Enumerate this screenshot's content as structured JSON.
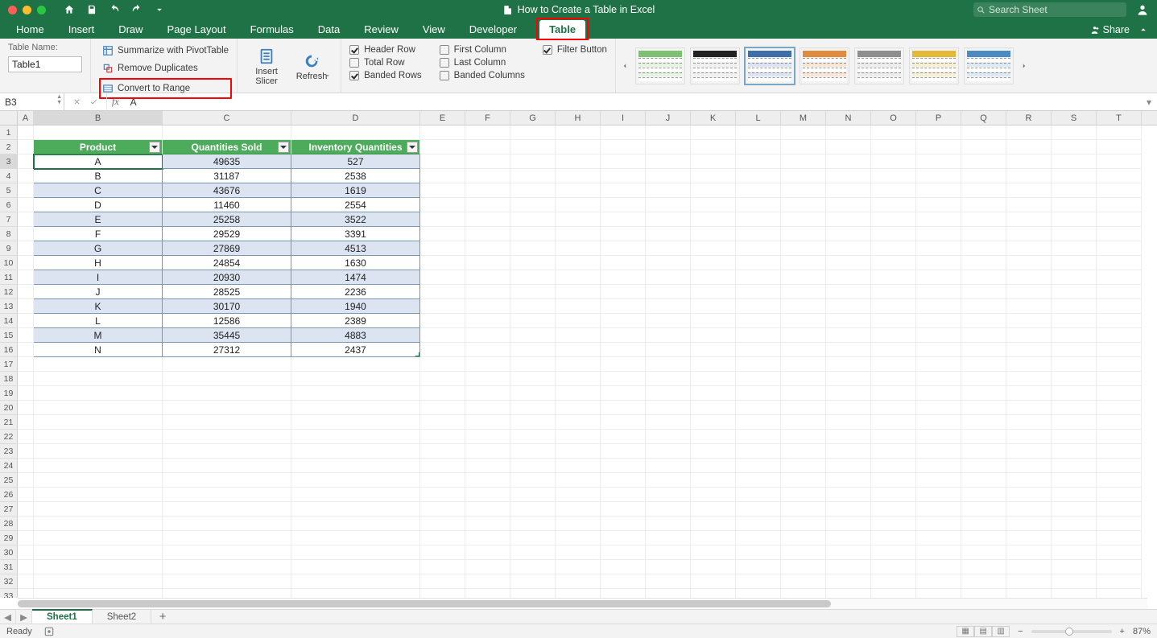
{
  "title": "How to Create a Table in Excel",
  "search_placeholder": "Search Sheet",
  "ribbon_tabs": [
    "Home",
    "Insert",
    "Draw",
    "Page Layout",
    "Formulas",
    "Data",
    "Review",
    "View",
    "Developer",
    "Table"
  ],
  "active_tab": "Table",
  "share_label": "Share",
  "table_name_label": "Table Name:",
  "table_name_value": "Table1",
  "tools": {
    "pivot": "Summarize with PivotTable",
    "dedup": "Remove Duplicates",
    "convert": "Convert to Range",
    "insert_slicer": "Insert Slicer",
    "refresh": "Refresh"
  },
  "options_col1": [
    {
      "label": "Header Row",
      "checked": true
    },
    {
      "label": "Total Row",
      "checked": false
    },
    {
      "label": "Banded Rows",
      "checked": true
    }
  ],
  "options_col2": [
    {
      "label": "First Column",
      "checked": false
    },
    {
      "label": "Last Column",
      "checked": false
    },
    {
      "label": "Banded Columns",
      "checked": false
    }
  ],
  "options_col3": [
    {
      "label": "Filter Button",
      "checked": true
    }
  ],
  "style_presets": [
    {
      "hdr": "#7fc173",
      "alt": "#e5f3e1",
      "sel": false
    },
    {
      "hdr": "#222222",
      "alt": "#f0f0f0",
      "sel": false
    },
    {
      "hdr": "#3f6fa8",
      "alt": "#dbe4f0",
      "sel": true
    },
    {
      "hdr": "#e08b3e",
      "alt": "#f7e6d6",
      "sel": false
    },
    {
      "hdr": "#8e8e8e",
      "alt": "#ececec",
      "sel": false
    },
    {
      "hdr": "#e3b93a",
      "alt": "#f7efd3",
      "sel": false
    },
    {
      "hdr": "#4a8cc2",
      "alt": "#dde9f3",
      "sel": false
    }
  ],
  "namebox": "B3",
  "formula": "A",
  "columns": [
    "A",
    "B",
    "C",
    "D",
    "E",
    "F",
    "G",
    "H",
    "I",
    "J",
    "K",
    "L",
    "M",
    "N",
    "O",
    "P",
    "Q",
    "R",
    "S",
    "T"
  ],
  "col_widths": {
    "A": 20,
    "B": 160,
    "C": 160,
    "D": 160,
    "default": 56
  },
  "table": {
    "start_col": 1,
    "start_row": 1,
    "headers": [
      "Product",
      "Quantities Sold",
      "Inventory Quantities"
    ],
    "rows": [
      [
        "A",
        49635,
        527
      ],
      [
        "B",
        31187,
        2538
      ],
      [
        "C",
        43676,
        1619
      ],
      [
        "D",
        11460,
        2554
      ],
      [
        "E",
        25258,
        3522
      ],
      [
        "F",
        29529,
        3391
      ],
      [
        "G",
        27869,
        4513
      ],
      [
        "H",
        24854,
        1630
      ],
      [
        "I",
        20930,
        1474
      ],
      [
        "J",
        28525,
        2236
      ],
      [
        "K",
        30170,
        1940
      ],
      [
        "L",
        12586,
        2389
      ],
      [
        "M",
        35445,
        4883
      ],
      [
        "N",
        27312,
        2437
      ]
    ]
  },
  "selected": {
    "col": "B",
    "row": 3
  },
  "total_rows_render": 34,
  "hscroll_thumb_pct": 72,
  "sheets": [
    "Sheet1",
    "Sheet2"
  ],
  "active_sheet": "Sheet1",
  "status_text": "Ready",
  "zoom": "87%",
  "zoom_knob_pct": 42
}
